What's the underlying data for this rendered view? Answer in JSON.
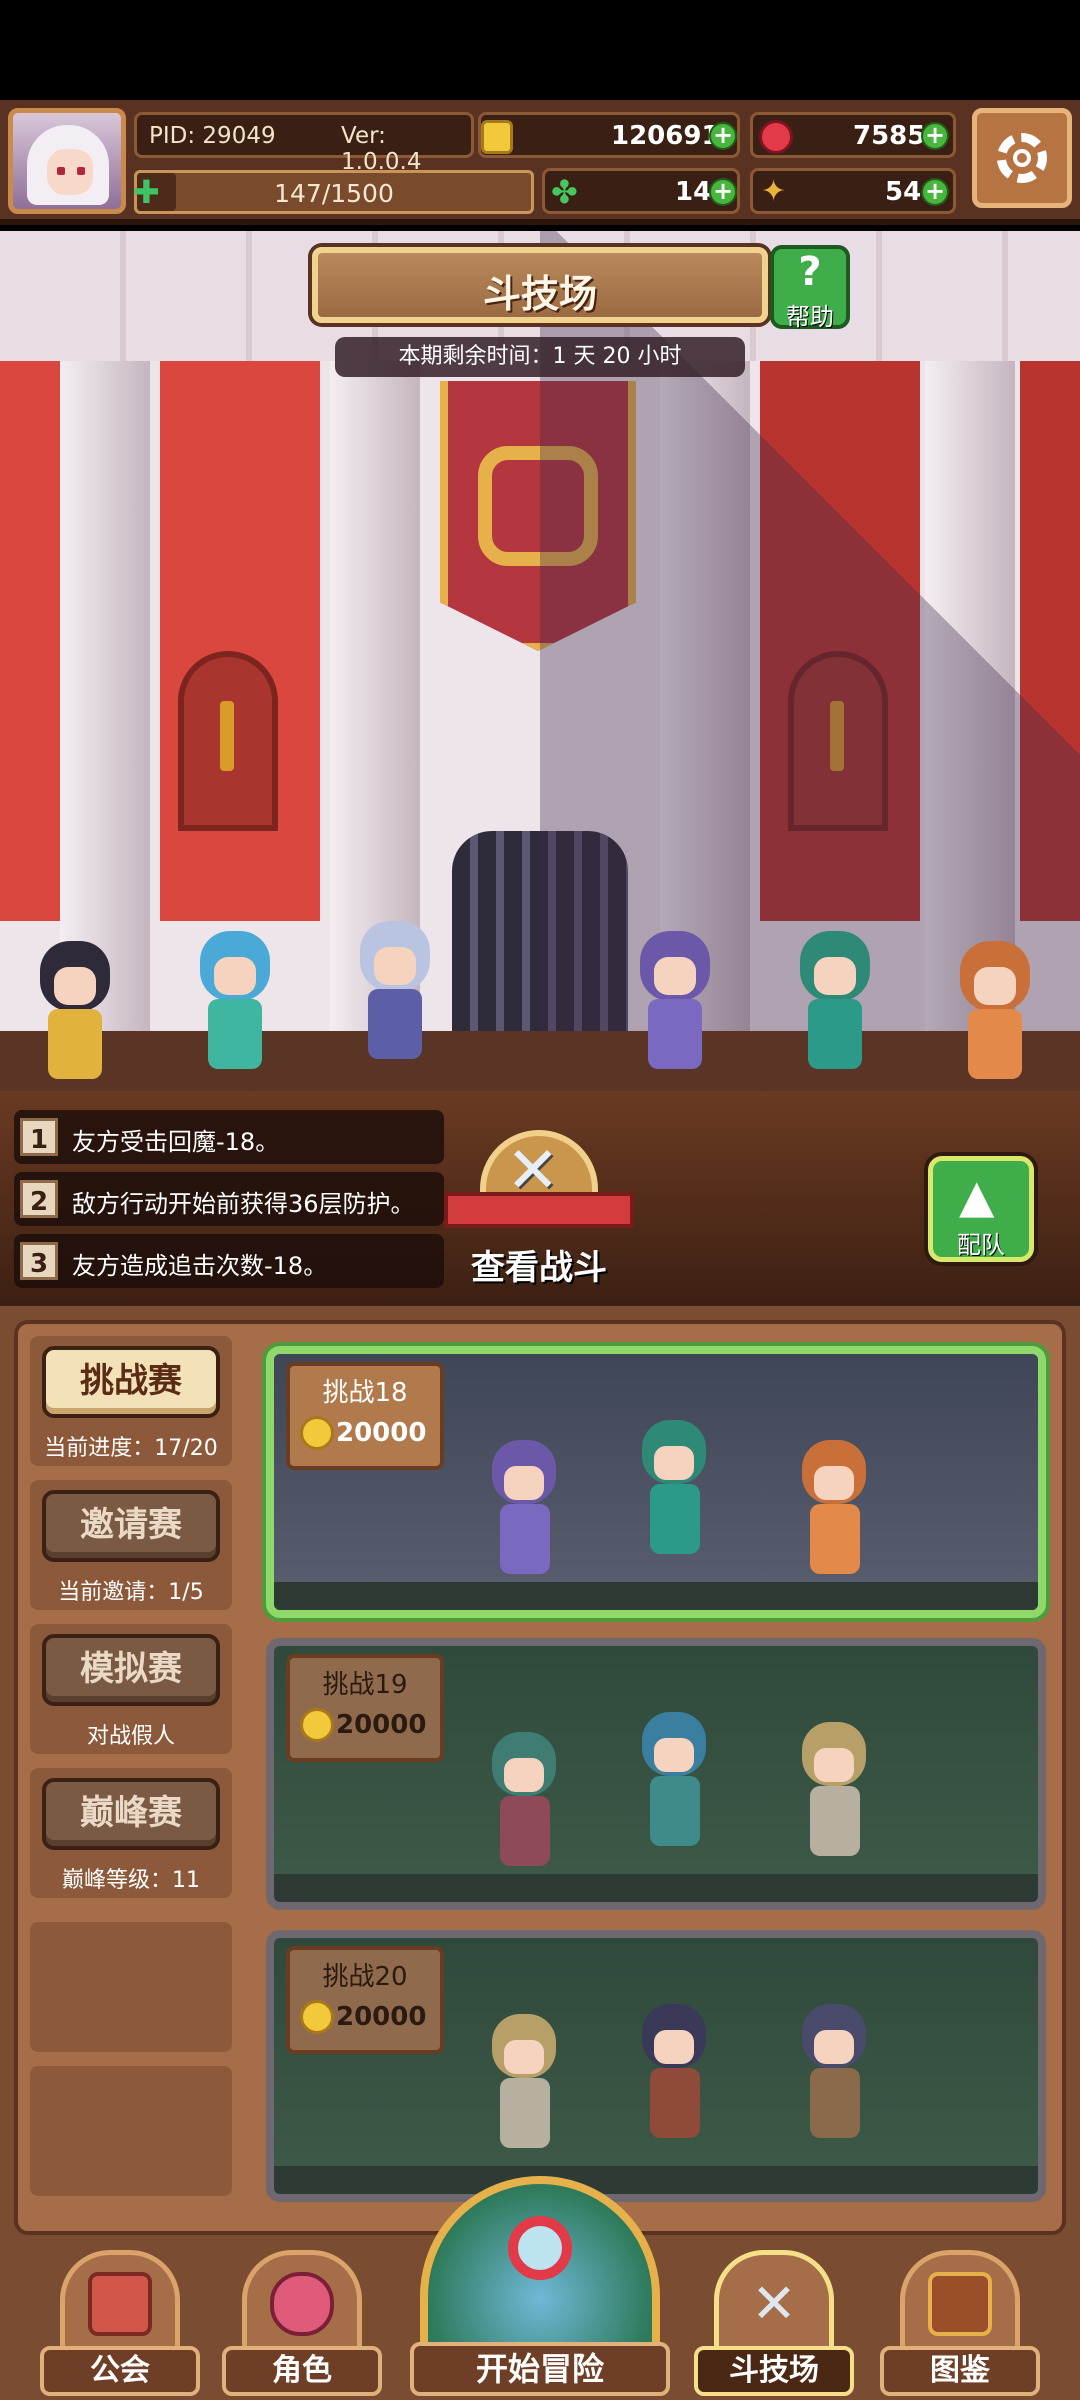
{
  "header": {
    "pid": "PID: 29049",
    "version": "Ver: 1.0.0.4",
    "gold": "120691",
    "gems": "7585",
    "energy": "147/1500",
    "energy_fraction": 0.098,
    "clover": "14",
    "keys": "54",
    "plus_symbol": "+"
  },
  "arena": {
    "title": "斗技场",
    "help_label": "帮助",
    "help_symbol": "?",
    "timer": "本期剩余时间：1 天 20 小时"
  },
  "buffs": [
    {
      "num": "1",
      "text": "友方受击回魔-18。"
    },
    {
      "num": "2",
      "text": "敌方行动开始前获得36层防护。"
    },
    {
      "num": "3",
      "text": "友方造成追击次数-18。"
    }
  ],
  "battle": {
    "view_fight": "查看战斗",
    "team_label": "配队"
  },
  "modes": [
    {
      "label": "挑战赛",
      "sub": "当前进度：17/20",
      "active": true
    },
    {
      "label": "邀请赛",
      "sub": "当前邀请：1/5",
      "active": false
    },
    {
      "label": "模拟赛",
      "sub": "对战假人",
      "active": false
    },
    {
      "label": "巅峰赛",
      "sub": "巅峰等级：11",
      "active": false
    }
  ],
  "challenges": [
    {
      "label": "挑战18",
      "reward": "20000",
      "selected": true
    },
    {
      "label": "挑战19",
      "reward": "20000",
      "selected": false
    },
    {
      "label": "挑战20",
      "reward": "20000",
      "selected": false
    }
  ],
  "nav": {
    "guild": "公会",
    "character": "角色",
    "adventure": "开始冒险",
    "arena": "斗技场",
    "codex": "图鉴"
  },
  "colors": {
    "accent_gold": "#e6b14a",
    "brand_brown": "#7a4c32",
    "selected_green": "#8fd86a",
    "plus_green": "#49b53f"
  }
}
